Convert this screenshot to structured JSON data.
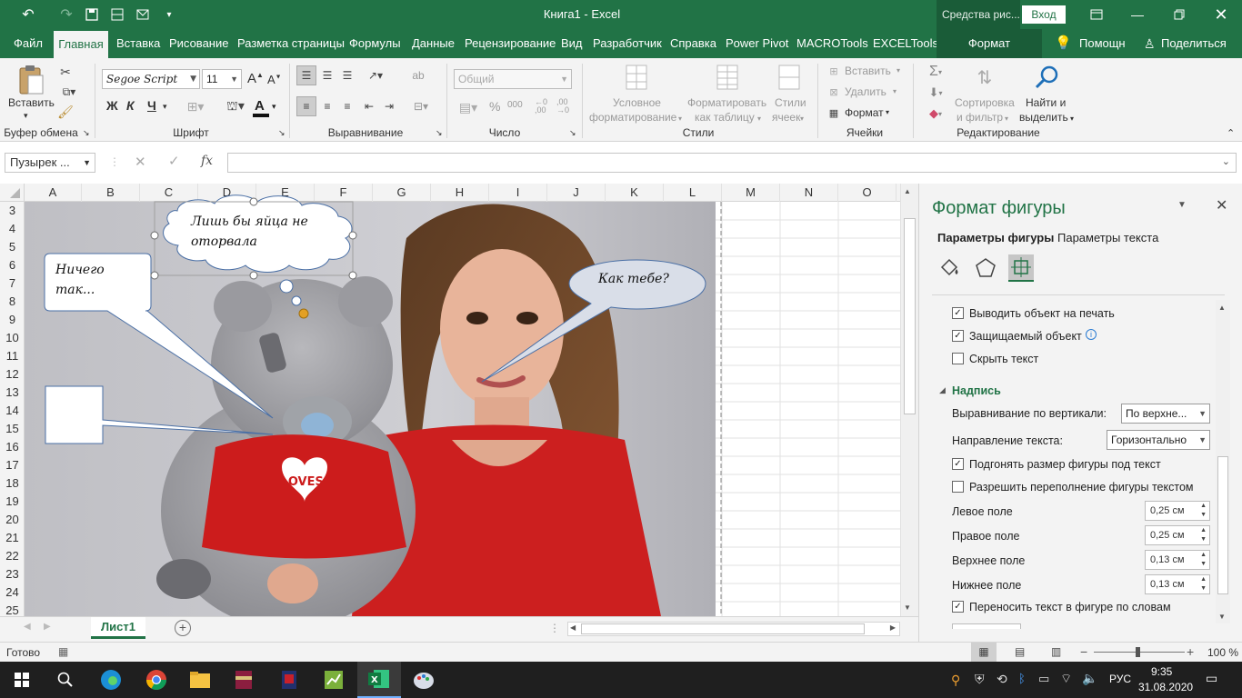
{
  "titlebar": {
    "title": "Книга1  -  Excel",
    "context_tools": "Средства рис...",
    "signin": "Вход"
  },
  "menu": {
    "tabs": [
      "Файл",
      "Главная",
      "Вставка",
      "Рисование",
      "Разметка страницы",
      "Формулы",
      "Данные",
      "Рецензирование",
      "Вид",
      "Разработчик",
      "Справка",
      "Power Pivot",
      "MACROTools",
      "EXCELTools",
      "Формат"
    ],
    "help": "Помощн",
    "share": "Поделиться"
  },
  "ribbon": {
    "clipboard": {
      "paste": "Вставить",
      "label": "Буфер обмена"
    },
    "font": {
      "name": "Segoe Script",
      "size": "11",
      "bold": "Ж",
      "italic": "К",
      "underline": "Ч",
      "label": "Шрифт"
    },
    "alignment": {
      "label": "Выравнивание"
    },
    "number": {
      "format": "Общий",
      "label": "Число"
    },
    "styles": {
      "cond1": "Условное",
      "cond2": "форматирование",
      "table1": "Форматировать",
      "table2": "как таблицу",
      "cell1": "Стили",
      "cell2": "ячеек",
      "label": "Стили"
    },
    "cells": {
      "insert": "Вставить",
      "delete": "Удалить",
      "format": "Формат",
      "label": "Ячейки"
    },
    "editing": {
      "sort1": "Сортировка",
      "sort2": "и фильтр",
      "find1": "Найти и",
      "find2": "выделить",
      "label": "Редактирование"
    }
  },
  "formula_bar": {
    "name_box": "Пузырек ...",
    "fx": "fx",
    "value": ""
  },
  "columns": [
    "A",
    "B",
    "C",
    "D",
    "E",
    "F",
    "G",
    "H",
    "I",
    "J",
    "K",
    "L",
    "M",
    "N",
    "O"
  ],
  "rows": [
    "3",
    "4",
    "5",
    "6",
    "7",
    "8",
    "9",
    "10",
    "11",
    "12",
    "13",
    "14",
    "15",
    "16",
    "17",
    "18",
    "19",
    "20",
    "21",
    "22",
    "23",
    "24",
    "25"
  ],
  "shapes": {
    "cloud_text": "Лишь бы яйца не оторвала",
    "rect_callout_text": "Ничего так...",
    "oval_callout_text": "Как тебе?",
    "heart_text": "LOVES"
  },
  "sheets": {
    "active": "Лист1"
  },
  "pane": {
    "title": "Формат фигуры",
    "tab_shape": "Параметры фигуры",
    "tab_text": "Параметры текста",
    "print_object": {
      "label": "Выводить объект на печать",
      "checked": true
    },
    "locked": {
      "label": "Защищаемый объект",
      "checked": true
    },
    "hide_text": {
      "label": "Скрыть текст",
      "checked": false
    },
    "section": "Надпись",
    "valign": {
      "label": "Выравнивание по вертикали:",
      "value": "По верхне..."
    },
    "text_dir": {
      "label": "Направление текста:",
      "value": "Горизонтально"
    },
    "autofit": {
      "label": "Подгонять размер фигуры под текст",
      "checked": true
    },
    "overflow": {
      "label": "Разрешить переполнение фигуры текстом",
      "checked": false
    },
    "left_margin": {
      "label": "Левое поле",
      "value": "0,25 см"
    },
    "right_margin": {
      "label": "Правое поле",
      "value": "0,25 см"
    },
    "top_margin": {
      "label": "Верхнее поле",
      "value": "0,13 см"
    },
    "bottom_margin": {
      "label": "Нижнее поле",
      "value": "0,13 см"
    },
    "wrap": {
      "label": "Переносить текст в фигуре по словам",
      "checked": true
    }
  },
  "status": {
    "ready": "Готово",
    "zoom": "100 %"
  },
  "taskbar": {
    "time": "9:35",
    "date": "31.08.2020",
    "lang": "РУС"
  },
  "colors": {
    "excel_green": "#217346",
    "link_green": "#217346"
  }
}
